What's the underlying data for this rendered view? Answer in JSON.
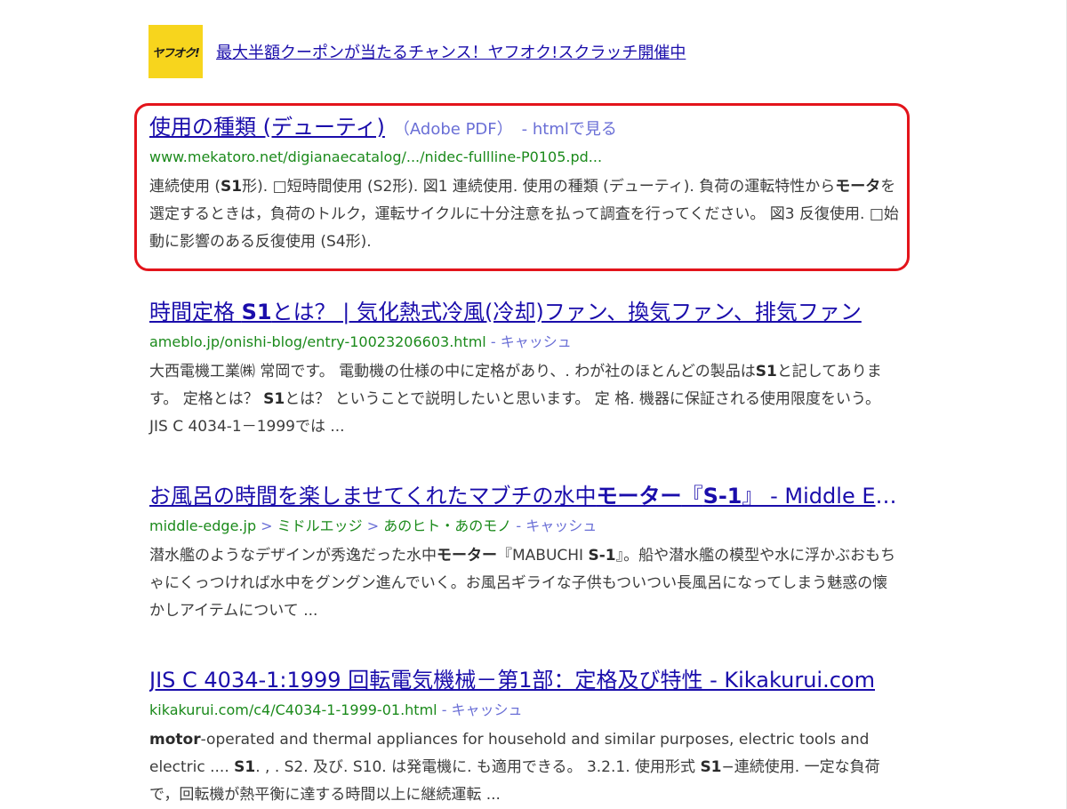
{
  "promo": {
    "logo_text": "ヤフオク!",
    "link": "最大半額クーポンが当たるチャンス！ヤフオク!スクラッチ開催中"
  },
  "results": [
    {
      "title": "使用の種類 (デューティ)",
      "filetype": "（Adobe PDF）",
      "html_view": "- htmlで見る",
      "url": "www.mekatoro.net/digianaecatalog/.../nidec-fullline-P0105.pd...",
      "snippet_parts": [
        {
          "t": "連続使用 ("
        },
        {
          "t": "S1",
          "b": true
        },
        {
          "t": "形). □短時間使用 (S2形). 図1 連続使用. 使用の種類 (デューティ). 負荷の運転特性から"
        },
        {
          "t": "モータ",
          "b": true
        },
        {
          "t": "を選定するときは，負荷のトルク，運転サイクルに十分注意を払って調査を行ってください。 図3 反復使用. □始動に影響のある反復使用 (S4形)."
        }
      ]
    },
    {
      "title_parts": [
        {
          "t": "時間定格 "
        },
        {
          "t": "S1",
          "b": true
        },
        {
          "t": "とは？ | 気化熱式冷風(冷却)ファン、換気ファン、排気ファン"
        }
      ],
      "url": "ameblo.jp/onishi-blog/entry-10023206603.html",
      "cache": "キャッシュ",
      "snippet_parts": [
        {
          "t": "大西電機工業㈱ 常岡です。 電動機の仕様の中に定格があり、. わが社のほとんどの製品は"
        },
        {
          "t": "S1",
          "b": true
        },
        {
          "t": "と記してあります。 定格とは？ "
        },
        {
          "t": "S1",
          "b": true
        },
        {
          "t": "とは？ ということで説明したいと思います。 定 格. 機器に保証される使用限度をいう。 JIS C 4034-1－1999では ..."
        }
      ]
    },
    {
      "title_parts": [
        {
          "t": "お風呂の時間を楽しませてくれたマブチの水中"
        },
        {
          "t": "モーター",
          "b": true
        },
        {
          "t": "『"
        },
        {
          "t": "S-1",
          "b": true
        },
        {
          "t": "』 - Middle Edge"
        }
      ],
      "url_parts": [
        {
          "t": "middle-edge.jp"
        },
        {
          "t": " > ",
          "sep": true
        },
        {
          "t": "ミドルエッジ"
        },
        {
          "t": " > ",
          "sep": true
        },
        {
          "t": "あのヒト・あのモノ"
        }
      ],
      "cache": "キャッシュ",
      "snippet_parts": [
        {
          "t": "潜水艦のようなデザインが秀逸だった水中"
        },
        {
          "t": "モーター",
          "b": true
        },
        {
          "t": "『MABUCHI "
        },
        {
          "t": "S-1",
          "b": true
        },
        {
          "t": "』。船や潜水艦の模型や水に浮かぶおもちゃにくっつければ水中をグングン進んでいく。お風呂ギライな子供もついつい長風呂になってしまう魅惑の懐かしアイテムについて ..."
        }
      ]
    },
    {
      "title": "JIS C 4034-1:1999 回転電気機械－第1部：定格及び特性 - Kikakurui.com",
      "url": "kikakurui.com/c4/C4034-1-1999-01.html",
      "cache": "キャッシュ",
      "snippet_parts": [
        {
          "t": "motor",
          "b": true
        },
        {
          "t": "-operated and thermal appliances for household and similar purposes, electric tools and electric .... "
        },
        {
          "t": "S1",
          "b": true
        },
        {
          "t": ". ,  . S2. 及び. S10. は発電機に. も適用できる。 3.2.1. 使用形式 "
        },
        {
          "t": "S1",
          "b": true
        },
        {
          "t": "−連続使用. 一定な負荷で，回転機が熱平衡に達する時間以上に継続運転 ..."
        }
      ]
    }
  ]
}
